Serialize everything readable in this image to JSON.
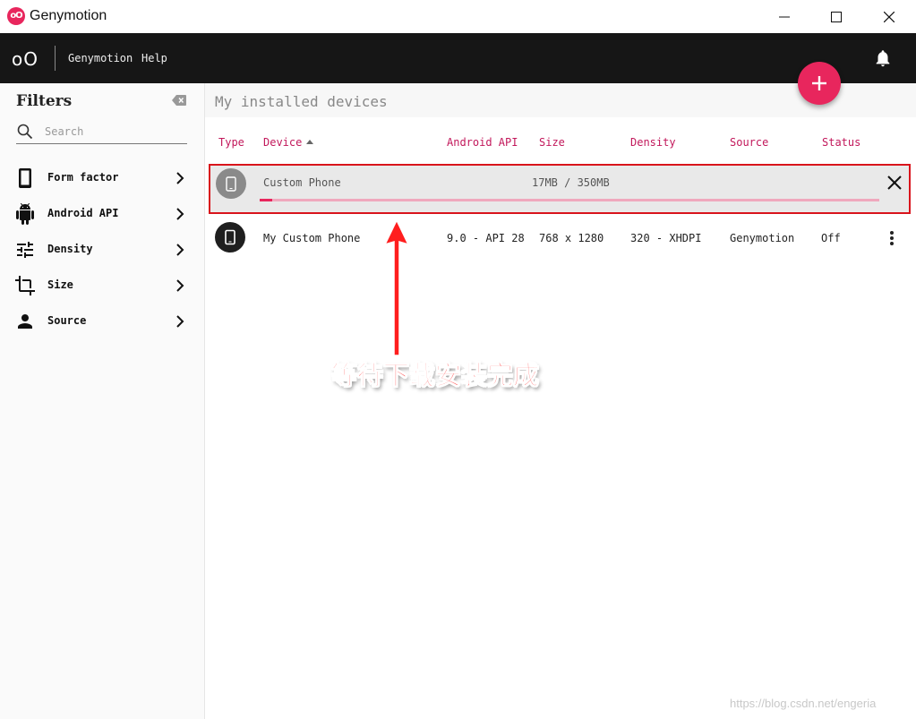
{
  "window": {
    "title": "Genymotion",
    "logo_text": "oO"
  },
  "topbar": {
    "logo_text": "oO",
    "menu": [
      "Genymotion",
      "Help"
    ]
  },
  "sidebar": {
    "title": "Filters",
    "search": {
      "placeholder": "Search",
      "value": ""
    },
    "items": [
      {
        "label": "Form factor",
        "icon": "phone-icon"
      },
      {
        "label": "Android API",
        "icon": "android-icon"
      },
      {
        "label": "Density",
        "icon": "sliders-icon"
      },
      {
        "label": "Size",
        "icon": "crop-icon"
      },
      {
        "label": "Source",
        "icon": "person-icon"
      }
    ]
  },
  "main": {
    "title": "My installed devices",
    "columns": [
      "Type",
      "Device",
      "Android API",
      "Size",
      "Density",
      "Source",
      "Status"
    ],
    "sort_column": "Device",
    "sort_direction": "ascending"
  },
  "download": {
    "name": "Custom Phone",
    "size_text": "17MB / 350MB",
    "progress": 0.02
  },
  "devices": [
    {
      "name": "My Custom Phone",
      "android_api": "9.0 - API 28",
      "size": "768 x 1280",
      "density": "320 - XHDPI",
      "source": "Genymotion",
      "status": "Off"
    }
  ],
  "annotation": {
    "text": "等待下载安装完成"
  },
  "watermark": "https://blog.csdn.net/engeria",
  "colors": {
    "accent": "#e8265d",
    "header_text": "#c2185b",
    "topbar": "#161616",
    "annotation": "#ff1e1e"
  }
}
